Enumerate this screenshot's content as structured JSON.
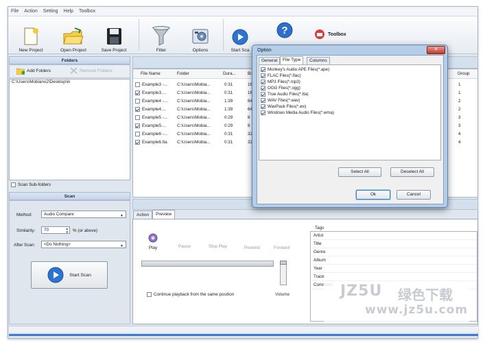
{
  "menu": [
    "File",
    "Action",
    "Setting",
    "Help",
    "Toolbox"
  ],
  "toolbar": {
    "new_project": "New Project",
    "open_project": "Open Project",
    "save_project": "Save Project",
    "filter": "Filter",
    "options": "Options",
    "start_scan": "Start Sca",
    "toolbox": "Toolbox"
  },
  "folders": {
    "header": "Folders",
    "add_label": "Add Folders",
    "remove_label": "Remove Folders",
    "path": "C:\\Users\\Mobiano2\\Desktop\\in",
    "subfolders_label": "Scan Sub-folders"
  },
  "scan": {
    "header": "Scan",
    "method_label": "Method:",
    "method_value": "Audio Compare",
    "similarity_label": "Similarity:",
    "similarity_value": "70",
    "similarity_unit": "% (or above)",
    "after_label": "After Scan:",
    "after_value": "<Do Nothing>",
    "start_label": "Start Scan"
  },
  "table": {
    "headers": [
      "File Name",
      "Folder",
      "Dura...",
      "Bi"
    ],
    "group_header": "Group",
    "rows": [
      {
        "checked": false,
        "name": "Example3 -...",
        "folder": "C:\\Users\\Mobia...",
        "dur": "0:31",
        "bi": "16"
      },
      {
        "checked": true,
        "name": "Example3....",
        "folder": "C:\\Users\\Mobia...",
        "dur": "0:31",
        "bi": "16"
      },
      {
        "checked": false,
        "name": "Example4 -...",
        "folder": "C:\\Users\\Mobia...",
        "dur": "1:39",
        "bi": "64"
      },
      {
        "checked": true,
        "name": "Example4....",
        "folder": "C:\\Users\\Mobia...",
        "dur": "1:39",
        "bi": "64"
      },
      {
        "checked": false,
        "name": "Example5 -...",
        "folder": "C:\\Users\\Mobia...",
        "dur": "0:29",
        "bi": "8"
      },
      {
        "checked": true,
        "name": "Example5....",
        "folder": "C:\\Users\\Mobia...",
        "dur": "0:29",
        "bi": "8"
      },
      {
        "checked": false,
        "name": "Example6 -...",
        "folder": "C:\\Users\\Mobia...",
        "dur": "0:31",
        "bi": "32"
      },
      {
        "checked": true,
        "name": "Example6.tta",
        "folder": "C:\\Users\\Mobia...",
        "dur": "0:31",
        "bi": "32"
      }
    ],
    "groups": [
      "1",
      "1",
      "2",
      "2",
      "3",
      "3",
      "4",
      "4"
    ]
  },
  "preview": {
    "tab_action": "Action",
    "tab_preview": "Preview",
    "play": "Play",
    "pause": "Pause",
    "stop": "Stop Play",
    "prev": "Prewind",
    "fwd": "Forward",
    "volume": "Volume",
    "continue_label": "Continue playback from the same position"
  },
  "tags": {
    "header": "Tags",
    "items": [
      "Artist",
      "Title",
      "Genre",
      "Album",
      "Year",
      "Track",
      "Comment"
    ]
  },
  "dialog": {
    "title": "Option",
    "tabs": [
      "General",
      "File Type",
      "Columns"
    ],
    "filetypes": [
      "Monkey's Audio APE Files(*.ape)",
      "FLAC Files(*.flac)",
      "MP3 Files(*.mp3)",
      "OGG Files(*.ogg)",
      "True Audio Files(*.tta)",
      "WAV Files(*.wav)",
      "WavPack Files(*.wv)",
      "Windows Media Audio Files(*.wma)"
    ],
    "select_all": "Select All",
    "deselect_all": "Deselect All",
    "ok": "Ok",
    "cancel": "Cancel"
  },
  "watermark": {
    "brand": "JZ5U",
    "cn": "绿色下载",
    "url": "www.jz5u.com"
  },
  "colors": {
    "accent": "#2f6fc9",
    "panel_header": "#c9d8ec",
    "dialog_frame": "#b4cde8"
  }
}
